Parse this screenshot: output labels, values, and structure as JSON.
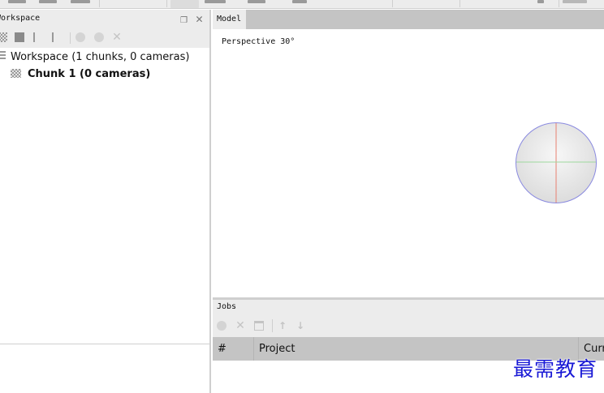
{
  "workspace_panel": {
    "title": "Workspace",
    "tree": [
      {
        "label": "Workspace (1 chunks, 0 cameras)"
      },
      {
        "label": "Chunk 1 (0 cameras)"
      }
    ]
  },
  "model_panel": {
    "tab": "Model",
    "viewport_label": "Perspective 30°"
  },
  "jobs_panel": {
    "title": "Jobs",
    "columns": [
      "#",
      "Project",
      "Curr"
    ]
  },
  "watermark": "最需教育"
}
